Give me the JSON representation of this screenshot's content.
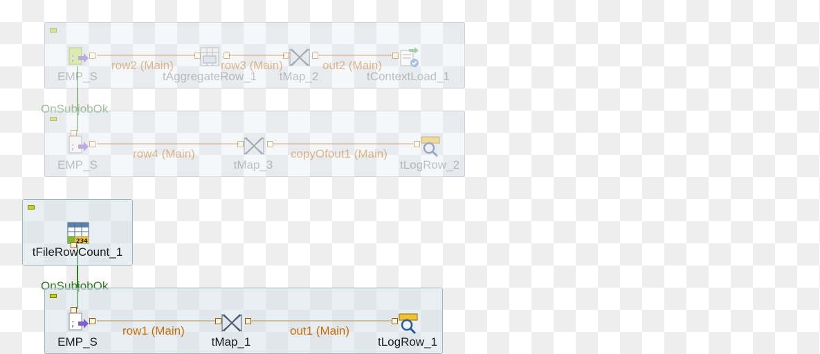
{
  "subjobs": [
    {
      "components": [
        "EMP_S",
        "tAggregateRow_1",
        "tMap_2",
        "tContextLoad_1"
      ],
      "links": [
        "row2 (Main)",
        "row3 (Main)",
        "out2 (Main)"
      ]
    },
    {
      "components": [
        "EMP_S",
        "tMap_3",
        "tLogRow_2"
      ],
      "links": [
        "row4 (Main)",
        "copyOfout1 (Main)"
      ]
    },
    {
      "components": [
        "tFileRowCount_1"
      ]
    },
    {
      "components": [
        "EMP_S",
        "tMap_1",
        "tLogRow_1"
      ],
      "links": [
        "row1 (Main)",
        "out1 (Main)"
      ]
    }
  ],
  "triggers": [
    "OnSubjobOk",
    "OnSubjobOk"
  ],
  "colors": {
    "main_link": "#e0842a",
    "trigger_link": "#2e7d22",
    "subjob_border": "#9fb2c0",
    "subjob_fill": "#d6e2ea"
  }
}
